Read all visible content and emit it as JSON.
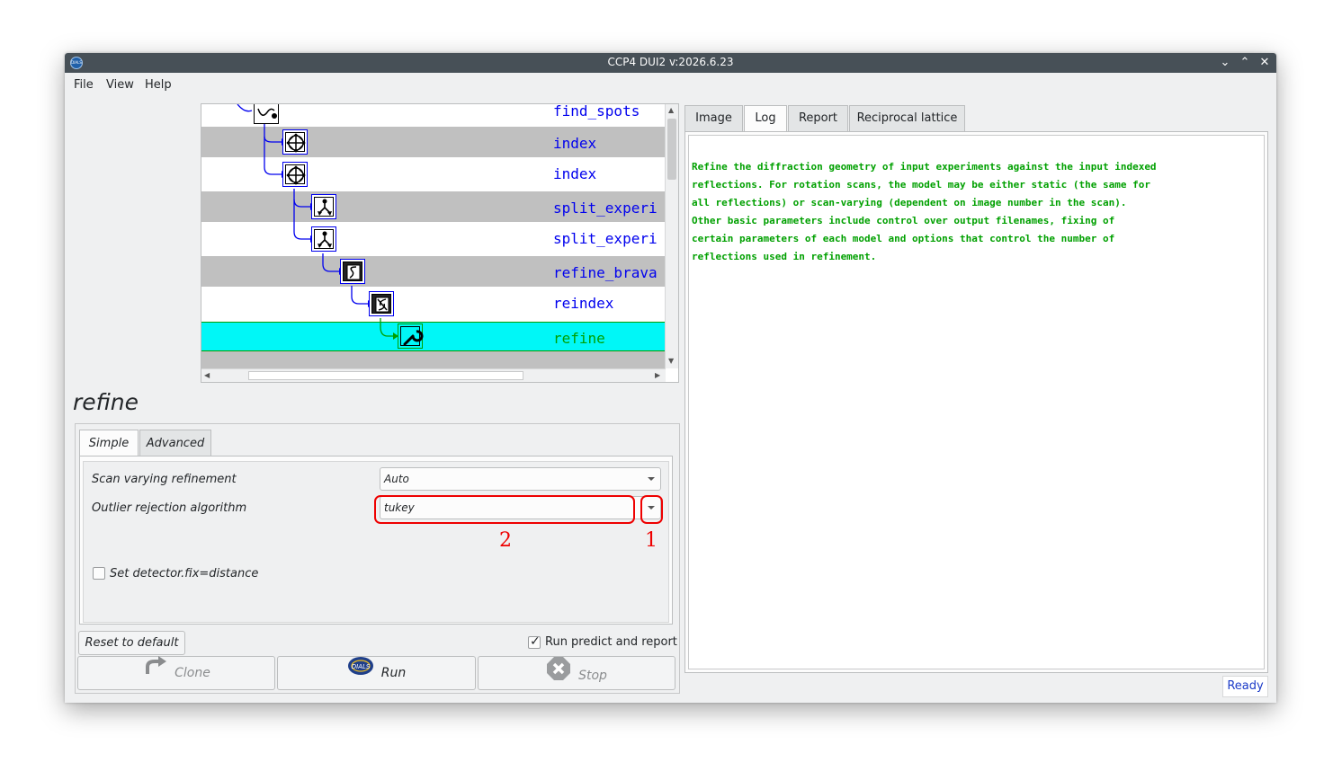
{
  "window": {
    "title": "CCP4 DUI2 v:2026.6.23",
    "app_icon_text": "DIALS",
    "controls": {
      "minimize": "⌄",
      "maximize": "⌃",
      "close": "✕"
    }
  },
  "menu": [
    "File",
    "View",
    "Help"
  ],
  "tree": {
    "nodes": [
      {
        "label": "find_spots",
        "icon": "find-spots-icon"
      },
      {
        "label": "index",
        "icon": "index-crosshair-icon"
      },
      {
        "label": "index",
        "icon": "index-crosshair-icon"
      },
      {
        "label": "split_experi",
        "icon": "split-experiments-icon"
      },
      {
        "label": "split_experi",
        "icon": "split-experiments-icon"
      },
      {
        "label": "refine_brava",
        "icon": "refine-bravais-icon"
      },
      {
        "label": "reindex",
        "icon": "reindex-icon"
      },
      {
        "label": "refine",
        "icon": "wrench-icon",
        "selected": true
      }
    ]
  },
  "step": {
    "title": "refine",
    "tabs": [
      "Simple",
      "Advanced"
    ],
    "params": {
      "scan_varying_label": "Scan varying refinement",
      "scan_varying_value": "Auto",
      "outlier_label": "Outlier rejection algorithm",
      "outlier_value": "tukey",
      "detector_fix_label": "Set detector.fix=distance"
    },
    "annotations": {
      "dropdown_arrow": "1",
      "combo_field": "2"
    },
    "reset_label": "Reset to default",
    "run_predict_label": "Run predict and report",
    "buttons": {
      "clone": "Clone",
      "run": "Run",
      "stop": "Stop",
      "run_icon_text": "DIALS"
    }
  },
  "right_tabs": [
    "Image",
    "Log",
    "Report",
    "Reciprocal lattice"
  ],
  "log": {
    "lines": [
      "Refine the diffraction geometry of input experiments against the input indexed",
      "reflections. For rotation scans, the model may be either static (the same for",
      "all reflections) or scan-varying (dependent on image number in the scan).",
      "Other basic parameters include control over output filenames, fixing of",
      "certain parameters of each model and options that control the number of",
      "reflections used in refinement."
    ]
  },
  "status": "Ready",
  "colors": {
    "link_blue": "#0000ee",
    "selected_cyan": "#00f7f7",
    "selected_green": "#00a000",
    "log_green": "#00a000",
    "annotation_red": "#ee0000"
  }
}
